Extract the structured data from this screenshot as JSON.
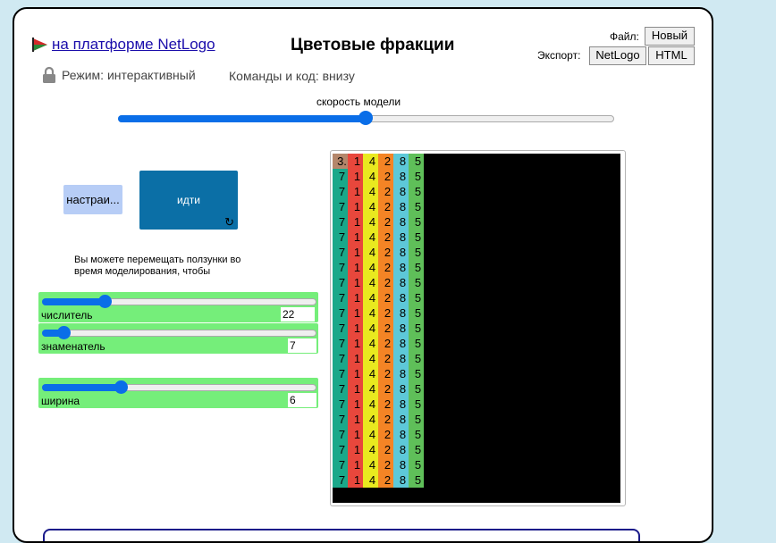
{
  "header": {
    "netlogo_link": "на платформе NetLogo",
    "title": "Цветовые фракции",
    "file_label": "Файл:",
    "new_button": "Новый",
    "export_label": "Экспорт:",
    "export_netlogo": "NetLogo",
    "export_html": "HTML",
    "mode": "Режим: интерактивный",
    "commands": "Команды и код: внизу"
  },
  "speed": {
    "label": "скорость модели",
    "value_fraction": 0.5
  },
  "buttons": {
    "setup": "настраи...",
    "go": "идти"
  },
  "note": "Вы можете перемещать ползунки во время моделирования, чтобы",
  "sliders": [
    {
      "name": "числитель",
      "value": "22",
      "fraction": 0.23
    },
    {
      "name": "знаменатель",
      "value": "7",
      "fraction": 0.08
    },
    {
      "name": "ширина",
      "value": "6",
      "fraction": 0.29
    }
  ],
  "view": {
    "columns": [
      {
        "digit": "7",
        "color": "#1aa88a",
        "first": "3.",
        "first_color": "#b4876b"
      },
      {
        "digit": "1",
        "color": "#e8473c"
      },
      {
        "digit": "4",
        "color": "#e9e91f"
      },
      {
        "digit": "2",
        "color": "#f48425"
      },
      {
        "digit": "8",
        "color": "#5dc8d8"
      },
      {
        "digit": "5",
        "color": "#5fbf59"
      }
    ],
    "rows": 22
  },
  "colors": {
    "background": "#d0e9f2",
    "slider_bg": "#75ee7a",
    "go_button": "#0b6fa6",
    "setup_button": "#b7cdf6",
    "accent": "#0a6ee8"
  }
}
